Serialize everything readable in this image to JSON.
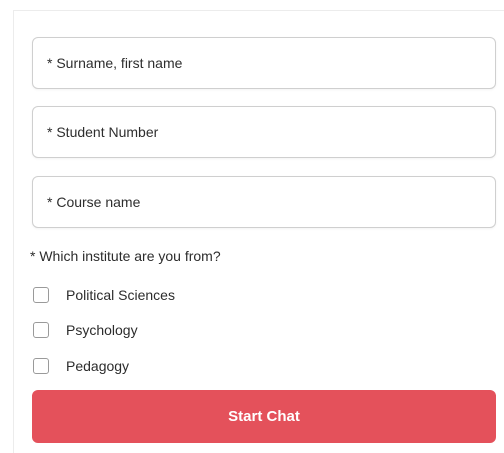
{
  "form": {
    "fields": [
      {
        "placeholder": "* Surname, first name",
        "value": ""
      },
      {
        "placeholder": "* Student Number",
        "value": ""
      },
      {
        "placeholder": "* Course name",
        "value": ""
      }
    ],
    "institute_question": "* Which institute are you from?",
    "institute_options": [
      {
        "label": "Political Sciences",
        "checked": false
      },
      {
        "label": "Psychology",
        "checked": false
      },
      {
        "label": "Pedagogy",
        "checked": false
      }
    ],
    "submit_label": "Start Chat"
  },
  "colors": {
    "accent": "#e4515b",
    "field_border": "#cfcfcf",
    "checkbox_border": "#9a9a9a",
    "text": "#2c2c2c"
  }
}
